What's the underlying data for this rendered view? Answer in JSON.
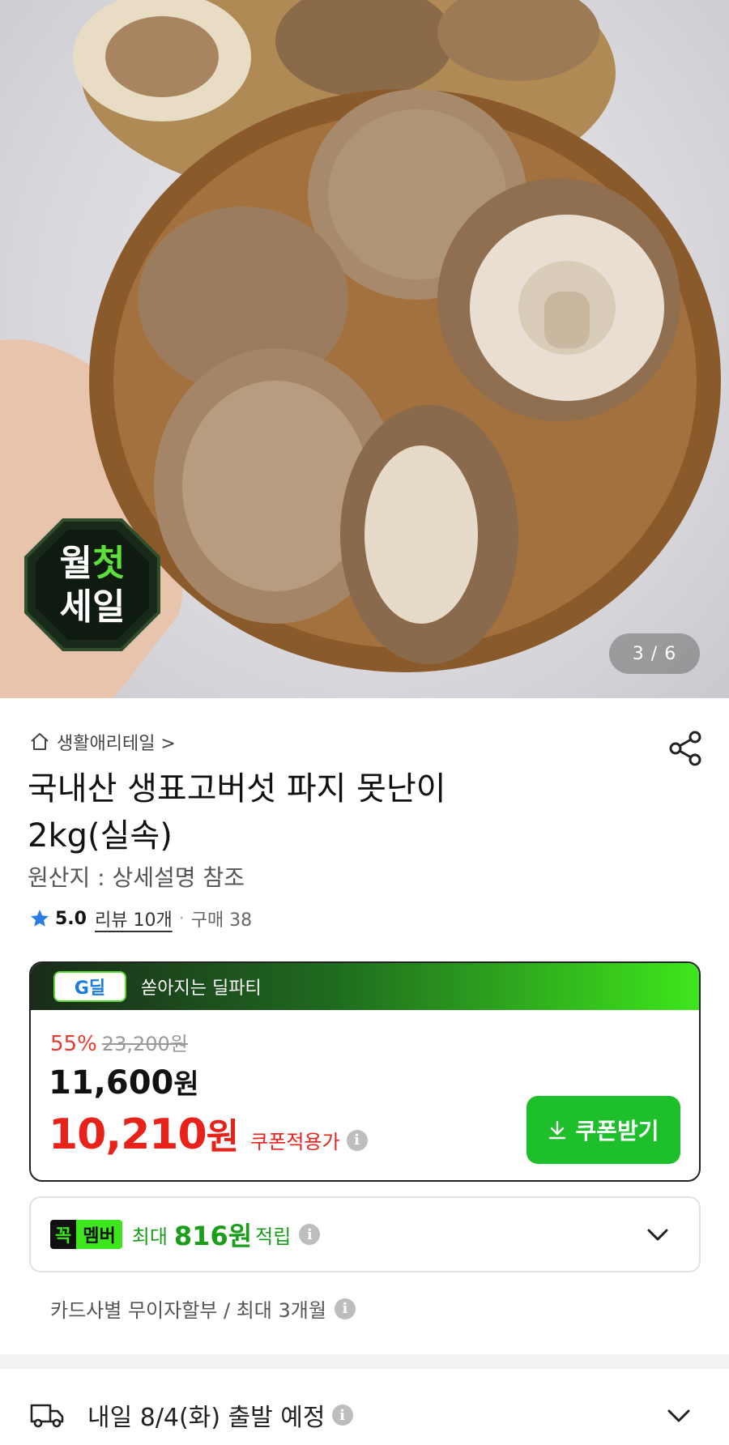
{
  "gallery": {
    "page_indicator": "3 / 6",
    "sale_badge_text": "월첫세일"
  },
  "product": {
    "breadcrumb": "생활애리테일 >",
    "title_line1": "국내산 생표고버섯 파지 못난이",
    "title_line2": "2kg(실속)",
    "origin": "원산지 : 상세설명 참조",
    "rating": "5.0",
    "review_label": "리뷰 10개",
    "purchase_label": "구매 38"
  },
  "deal": {
    "logo_text": "G딜",
    "banner_text": "쏟아지는 딜파티",
    "discount_rate": "55%",
    "original_price": "23,200원",
    "price_value": "11,600",
    "price_unit": "원",
    "coupon_price_value": "10,210",
    "coupon_price_unit": "원",
    "coupon_price_label": "쿠폰적용가",
    "coupon_button_label": "쿠폰받기"
  },
  "membership": {
    "badge_a": "꼭",
    "badge_b": "멤버",
    "prefix": "최대",
    "amount": "816원",
    "suffix": "적립"
  },
  "installment": "카드사별 무이자할부 / 최대 3개월",
  "shipping": "내일 8/4(화) 출발 예정",
  "colors": {
    "accent_green": "#1dbf2a",
    "sale_red": "#e8211a",
    "member_green": "#1a9e1a"
  }
}
